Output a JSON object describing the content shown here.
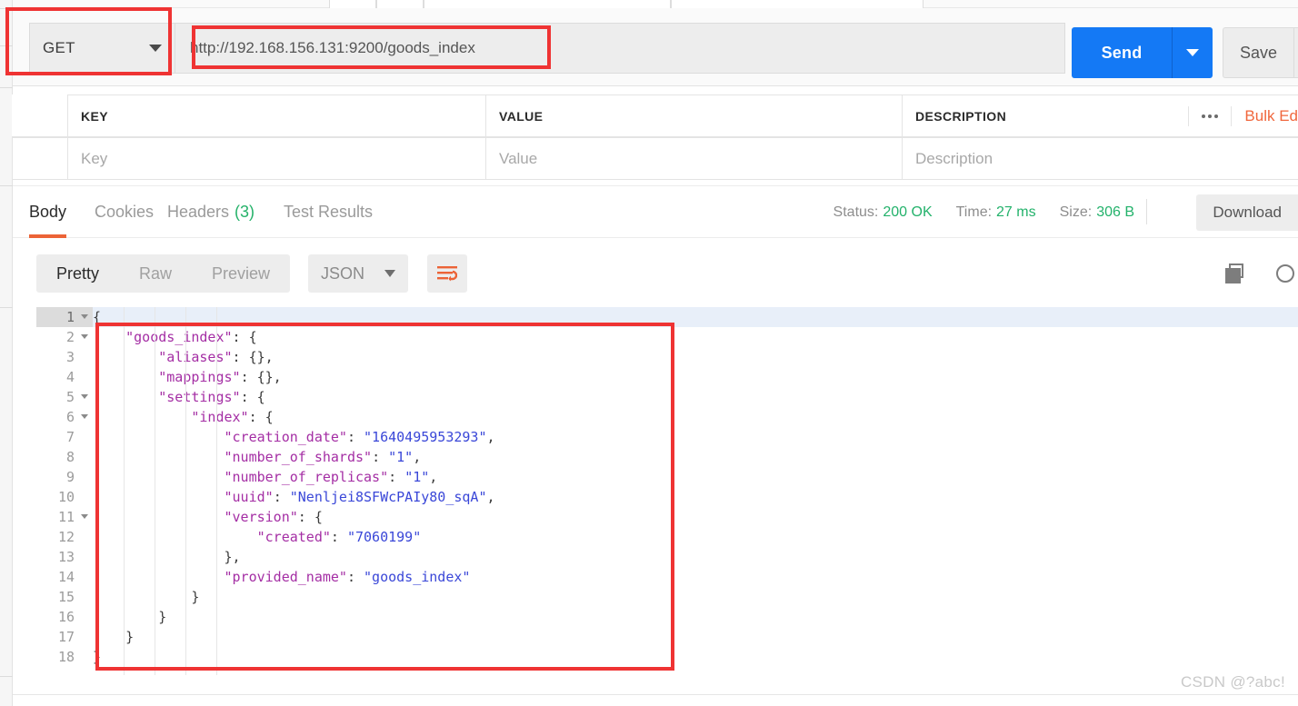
{
  "request": {
    "method": "GET",
    "url": "http://192.168.156.131:9200/goods_index",
    "send_label": "Send",
    "save_label": "Save"
  },
  "params": {
    "headers": [
      "KEY",
      "VALUE",
      "DESCRIPTION"
    ],
    "placeholders": [
      "Key",
      "Value",
      "Description"
    ],
    "bulk_edit_label": "Bulk Ed",
    "more_icon": "ellipsis-icon"
  },
  "response": {
    "tabs": [
      {
        "label": "Body",
        "active": true
      },
      {
        "label": "Cookies",
        "active": false
      },
      {
        "label": "Headers",
        "count": "(3)",
        "active": false
      },
      {
        "label": "Test Results",
        "active": false
      }
    ],
    "meta": {
      "status_label": "Status:",
      "status_value": "200 OK",
      "time_label": "Time:",
      "time_value": "27 ms",
      "size_label": "Size:",
      "size_value": "306 B"
    },
    "download_label": "Download",
    "view_modes": [
      {
        "label": "Pretty",
        "active": true
      },
      {
        "label": "Raw",
        "active": false
      },
      {
        "label": "Preview",
        "active": false
      }
    ],
    "format": "JSON",
    "wrap_icon": "word-wrap-icon",
    "copy_icon": "copy-icon",
    "search_icon": "search-icon"
  },
  "code": {
    "lines": [
      {
        "n": "1",
        "fold": true,
        "active": true,
        "indent": 0,
        "tokens": [
          {
            "t": "p",
            "v": "{"
          }
        ]
      },
      {
        "n": "2",
        "fold": true,
        "active": false,
        "indent": 1,
        "tokens": [
          {
            "t": "k",
            "v": "\"goods_index\""
          },
          {
            "t": "p",
            "v": ": {"
          }
        ]
      },
      {
        "n": "3",
        "fold": false,
        "active": false,
        "indent": 2,
        "tokens": [
          {
            "t": "k",
            "v": "\"aliases\""
          },
          {
            "t": "p",
            "v": ": {},"
          }
        ]
      },
      {
        "n": "4",
        "fold": false,
        "active": false,
        "indent": 2,
        "tokens": [
          {
            "t": "k",
            "v": "\"mappings\""
          },
          {
            "t": "p",
            "v": ": {},"
          }
        ]
      },
      {
        "n": "5",
        "fold": true,
        "active": false,
        "indent": 2,
        "tokens": [
          {
            "t": "k",
            "v": "\"settings\""
          },
          {
            "t": "p",
            "v": ": {"
          }
        ]
      },
      {
        "n": "6",
        "fold": true,
        "active": false,
        "indent": 3,
        "tokens": [
          {
            "t": "k",
            "v": "\"index\""
          },
          {
            "t": "p",
            "v": ": {"
          }
        ]
      },
      {
        "n": "7",
        "fold": false,
        "active": false,
        "indent": 4,
        "tokens": [
          {
            "t": "k",
            "v": "\"creation_date\""
          },
          {
            "t": "p",
            "v": ": "
          },
          {
            "t": "s",
            "v": "\"1640495953293\""
          },
          {
            "t": "p",
            "v": ","
          }
        ]
      },
      {
        "n": "8",
        "fold": false,
        "active": false,
        "indent": 4,
        "tokens": [
          {
            "t": "k",
            "v": "\"number_of_shards\""
          },
          {
            "t": "p",
            "v": ": "
          },
          {
            "t": "s",
            "v": "\"1\""
          },
          {
            "t": "p",
            "v": ","
          }
        ]
      },
      {
        "n": "9",
        "fold": false,
        "active": false,
        "indent": 4,
        "tokens": [
          {
            "t": "k",
            "v": "\"number_of_replicas\""
          },
          {
            "t": "p",
            "v": ": "
          },
          {
            "t": "s",
            "v": "\"1\""
          },
          {
            "t": "p",
            "v": ","
          }
        ]
      },
      {
        "n": "10",
        "fold": false,
        "active": false,
        "indent": 4,
        "tokens": [
          {
            "t": "k",
            "v": "\"uuid\""
          },
          {
            "t": "p",
            "v": ": "
          },
          {
            "t": "s",
            "v": "\"Nenljei8SFWcPAIy80_sqA\""
          },
          {
            "t": "p",
            "v": ","
          }
        ]
      },
      {
        "n": "11",
        "fold": true,
        "active": false,
        "indent": 4,
        "tokens": [
          {
            "t": "k",
            "v": "\"version\""
          },
          {
            "t": "p",
            "v": ": {"
          }
        ]
      },
      {
        "n": "12",
        "fold": false,
        "active": false,
        "indent": 5,
        "tokens": [
          {
            "t": "k",
            "v": "\"created\""
          },
          {
            "t": "p",
            "v": ": "
          },
          {
            "t": "s",
            "v": "\"7060199\""
          }
        ]
      },
      {
        "n": "13",
        "fold": false,
        "active": false,
        "indent": 4,
        "tokens": [
          {
            "t": "p",
            "v": "},"
          }
        ]
      },
      {
        "n": "14",
        "fold": false,
        "active": false,
        "indent": 4,
        "tokens": [
          {
            "t": "k",
            "v": "\"provided_name\""
          },
          {
            "t": "p",
            "v": ": "
          },
          {
            "t": "s",
            "v": "\"goods_index\""
          }
        ]
      },
      {
        "n": "15",
        "fold": false,
        "active": false,
        "indent": 3,
        "tokens": [
          {
            "t": "p",
            "v": "}"
          }
        ]
      },
      {
        "n": "16",
        "fold": false,
        "active": false,
        "indent": 2,
        "tokens": [
          {
            "t": "p",
            "v": "}"
          }
        ]
      },
      {
        "n": "17",
        "fold": false,
        "active": false,
        "indent": 1,
        "tokens": [
          {
            "t": "p",
            "v": "}"
          }
        ]
      },
      {
        "n": "18",
        "fold": false,
        "active": false,
        "indent": 0,
        "tokens": [
          {
            "t": "p",
            "v": "}"
          }
        ]
      }
    ]
  },
  "watermark": "CSDN @?abc!",
  "colors": {
    "accent_blue": "#1479f5",
    "accent_orange": "#ec6337",
    "status_green": "#23b26b",
    "annotation_red": "#ef3333",
    "json_key": "#a42ea4",
    "json_string": "#3a47d8"
  }
}
